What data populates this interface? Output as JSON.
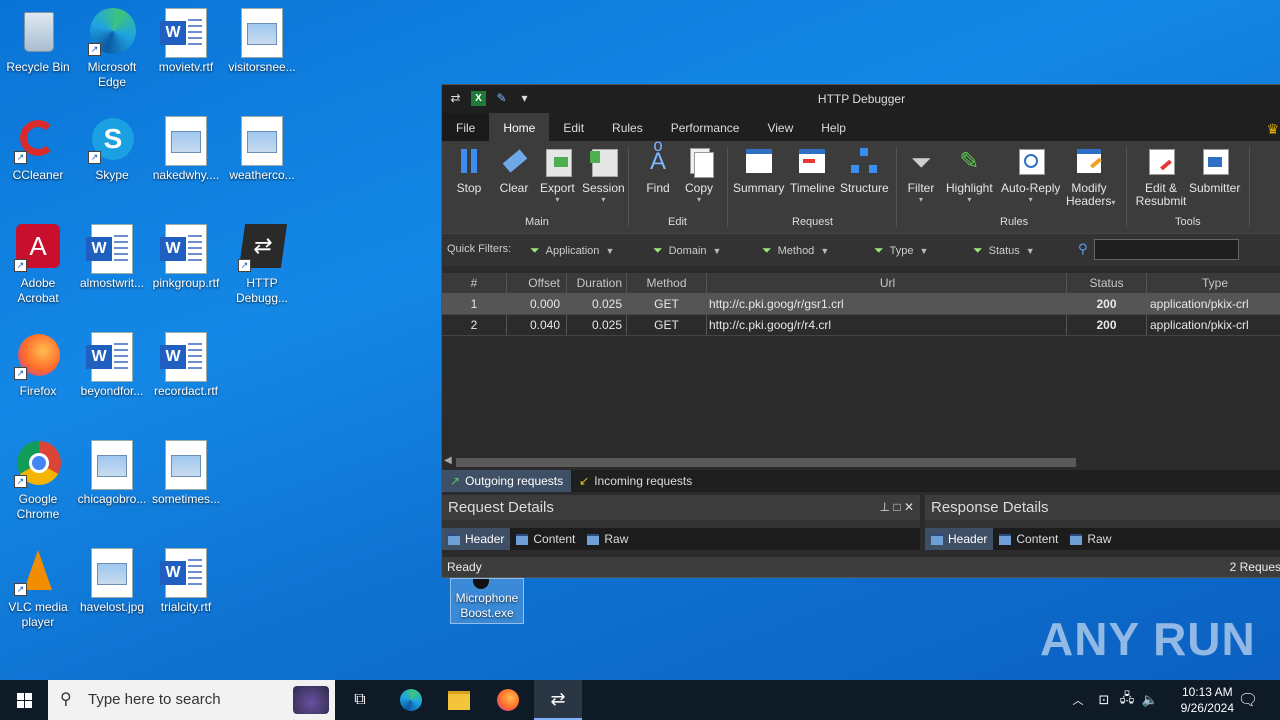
{
  "desktop": {
    "icons": [
      {
        "label": "Recycle Bin"
      },
      {
        "label": "Microsoft Edge"
      },
      {
        "label": "movietv.rtf"
      },
      {
        "label": "visitorsnee..."
      },
      {
        "label": "CCleaner"
      },
      {
        "label": "Skype"
      },
      {
        "label": "nakedwhy...."
      },
      {
        "label": "weatherco..."
      },
      {
        "label": "Adobe Acrobat"
      },
      {
        "label": "almostwrit..."
      },
      {
        "label": "pinkgroup.rtf"
      },
      {
        "label": "HTTP Debugg..."
      },
      {
        "label": "Firefox"
      },
      {
        "label": "beyondfor..."
      },
      {
        "label": "recordact.rtf"
      },
      {
        "label": "Google Chrome"
      },
      {
        "label": "chicagobro..."
      },
      {
        "label": "sometimes..."
      },
      {
        "label": "VLC media player"
      },
      {
        "label": "havelost.jpg"
      },
      {
        "label": "trialcity.rtf"
      },
      {
        "label": "Microphone Boost.exe"
      }
    ]
  },
  "window": {
    "title": "HTTP Debugger",
    "menu_tabs": [
      "File",
      "Home",
      "Edit",
      "Rules",
      "Performance",
      "View",
      "Help"
    ],
    "ribbon": {
      "buttons": [
        "Stop",
        "Clear",
        "Export",
        "Session",
        "Find",
        "Copy",
        "Summary",
        "Timeline",
        "Structure",
        "Filter",
        "Highlight",
        "Auto-Reply",
        "Modify Headers",
        "Edit & Resubmit",
        "Submitter"
      ],
      "groups": [
        "Main",
        "Edit",
        "Request",
        "Rules",
        "Tools"
      ]
    },
    "quick_filters": {
      "label": "Quick Filters:",
      "items": [
        "Application",
        "Domain",
        "Method",
        "Type",
        "Status"
      ]
    },
    "grid": {
      "columns": [
        "#",
        "Offset",
        "Duration",
        "Method",
        "Url",
        "Status",
        "Type"
      ],
      "rows": [
        {
          "num": "1",
          "offset": "0.000",
          "duration": "0.025",
          "method": "GET",
          "url": "http://c.pki.goog/r/gsr1.crl",
          "status": "200",
          "type": "application/pkix-crl"
        },
        {
          "num": "2",
          "offset": "0.040",
          "duration": "0.025",
          "method": "GET",
          "url": "http://c.pki.goog/r/r4.crl",
          "status": "200",
          "type": "application/pkix-crl"
        }
      ]
    },
    "request_tabs": [
      "Outgoing requests",
      "Incoming requests"
    ],
    "request_details": {
      "title": "Request Details",
      "tabs": [
        "Header",
        "Content",
        "Raw"
      ]
    },
    "response_details": {
      "title": "Response Details",
      "tabs": [
        "Header",
        "Content",
        "Raw"
      ]
    },
    "status": {
      "left": "Ready",
      "right": "2 Reques"
    }
  },
  "taskbar": {
    "search_placeholder": "Type here to search",
    "time": "10:13 AM",
    "date": "9/26/2024"
  },
  "watermark": "ANY RUN"
}
